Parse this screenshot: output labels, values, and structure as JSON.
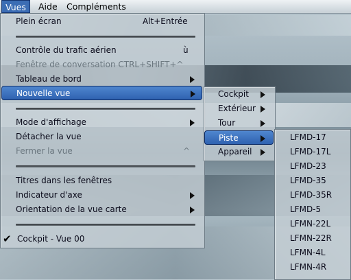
{
  "menubar": {
    "items": [
      "Vues",
      "Aide",
      "Compléments"
    ]
  },
  "main_menu": {
    "items": [
      {
        "label": "Plein écran",
        "shortcut": "Alt+Entrée"
      },
      {
        "label": "Contrôle du trafic aérien",
        "shortcut": "ù"
      },
      {
        "label": "Fenêtre de conversation CTRL+SHIFT+^",
        "disabled": true
      },
      {
        "label": "Tableau de bord",
        "submenu": true
      },
      {
        "label": "Nouvelle vue",
        "submenu": true,
        "highlighted": true
      },
      {
        "label": "Mode d'affichage",
        "submenu": true
      },
      {
        "label": "Détacher la vue"
      },
      {
        "label": "Fermer la vue",
        "shortcut": "^",
        "disabled": true
      },
      {
        "label": "Titres dans les fenêtres"
      },
      {
        "label": "Indicateur d'axe",
        "submenu": true
      },
      {
        "label": "Orientation de la vue carte",
        "submenu": true
      },
      {
        "label": "Cockpit - Vue 00",
        "checked": true
      }
    ]
  },
  "submenu_nouvelle_vue": {
    "items": [
      "Cockpit",
      "Extérieur",
      "Tour",
      "Piste",
      "Appareil"
    ],
    "highlighted": "Piste"
  },
  "submenu_piste": {
    "items": [
      "LFMD-17",
      "LFMD-17L",
      "LFMD-23",
      "LFMD-35",
      "LFMD-35R",
      "LFMD-5",
      "LFMN-22L",
      "LFMN-22R",
      "LFMN-4L",
      "LFMN-4R"
    ]
  },
  "colors": {
    "highlight": "#3c6db4",
    "menu_bg": "#c4ced4",
    "disabled_text": "#6c7880"
  }
}
